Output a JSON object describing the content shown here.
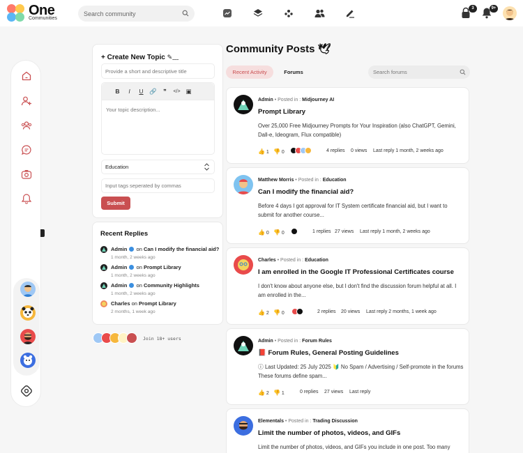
{
  "brand": {
    "name": "One",
    "sub": "Communities"
  },
  "search": {
    "placeholder": "Search community"
  },
  "notifications": {
    "messages_count": "3",
    "alerts_count": "9+"
  },
  "create": {
    "title": "+ Create New Topic",
    "title_placeholder": "Provide a short and descriptive title",
    "desc_placeholder": "Your topic description...",
    "category": "Education",
    "tags_placeholder": "Input tags seperated by commas",
    "submit": "Submit",
    "toolbar": [
      "B",
      "I",
      "U",
      "🔗",
      "❞",
      "</>",
      "▣"
    ]
  },
  "recent": {
    "title": "Recent Replies",
    "items": [
      {
        "user": "Admin",
        "on": "on",
        "topic": "Can I modify the financial aid?",
        "time": "1 month, 2 weeks ago"
      },
      {
        "user": "Admin",
        "on": "on",
        "topic": "Prompt Library",
        "time": "1 month, 2 weeks ago"
      },
      {
        "user": "Admin",
        "on": "on",
        "topic": "Community Highlights",
        "time": "1 month, 2 weeks ago"
      },
      {
        "user": "Charles",
        "on": "on",
        "topic": "Prompt Library",
        "time": "2 months, 1 week ago"
      }
    ]
  },
  "join": {
    "text": "Join 18+ users"
  },
  "main": {
    "title": "Community Posts 🕊",
    "tabs": [
      "Recent Activity",
      "Forums"
    ],
    "forum_search_placeholder": "Search forums",
    "posted_in": "• Posted in :",
    "posts": [
      {
        "author": "Admin",
        "forum": "Midjourney AI",
        "title": "Prompt Library",
        "body": "Over 25,000 Free Midjourney Prompts for Your Inspiration (also ChatGPT, Gemini, Dall-e, Ideogram, Flux compatible)",
        "likes": "1",
        "dislikes": "0",
        "replies": "4 replies",
        "views": "0 views",
        "last": "Last reply 1 month, 2 weeks ago"
      },
      {
        "author": "Matthew Morris",
        "forum": "Education",
        "title": "Can I modify the financial aid?",
        "body": "Before 4 days I got approval for IT System certificate financial aid, but I want to submit for another course...",
        "likes": "0",
        "dislikes": "0",
        "replies": "1 replies",
        "views": "27 views",
        "last": "Last reply 1 month, 2 weeks ago"
      },
      {
        "author": "Charles",
        "forum": "Education",
        "title": "I am enrolled in the Google IT Professional Certificates course",
        "body": "I don't know about anyone else, but I don't find the discussion forum helpful at all. I am enrolled in the...",
        "likes": "2",
        "dislikes": "0",
        "replies": "2 replies",
        "views": "20 views",
        "last": "Last reply 2 months, 1 week ago"
      },
      {
        "author": "Admin",
        "forum": "Forum Rules",
        "title": "📕 Forum Rules, General Posting Guidelines",
        "body": "ⓘ Last Updated: 25 July 2025 🔰 No Spam / Advertising / Self-promote in the forums These forums define spam...",
        "likes": "2",
        "dislikes": "1",
        "replies": "0 replies",
        "views": "27 views",
        "last": "Last reply"
      },
      {
        "author": "Elementals",
        "forum": "Trading Discussion",
        "title": "Limit the number of photos, videos, and GIFs",
        "body": "Limit the number of photos, videos, and GIFs you include in one post. Too many",
        "likes": "",
        "dislikes": "",
        "replies": "",
        "views": "",
        "last": ""
      }
    ]
  },
  "colors": {
    "accent": "#c94f51",
    "tab_bg": "#f6dede"
  }
}
